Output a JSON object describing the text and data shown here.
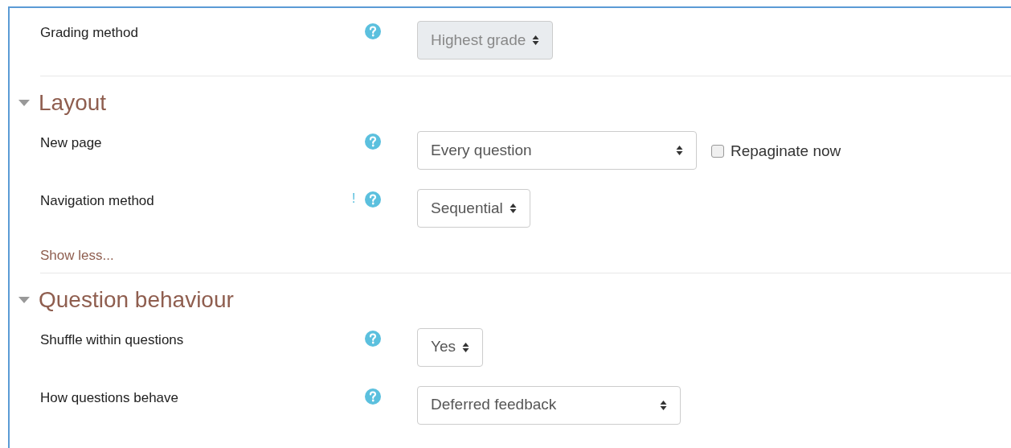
{
  "top_fields": [
    {
      "label": "Grading method",
      "help": true,
      "select": {
        "value": "Highest grade",
        "disabled": true,
        "kind": "auto"
      }
    }
  ],
  "sections": [
    {
      "title": "Layout",
      "expanded": true,
      "fields": [
        {
          "label": "New page",
          "help": true,
          "select": {
            "value": "Every question",
            "disabled": false,
            "kind": "wide"
          },
          "checkbox": {
            "label": "Repaginate now",
            "checked": false
          }
        },
        {
          "label": "Navigation method",
          "advanced_mark": "!",
          "help": true,
          "select": {
            "value": "Sequential",
            "disabled": false,
            "kind": "auto"
          }
        }
      ],
      "toggle_link": "Show less..."
    },
    {
      "title": "Question behaviour",
      "expanded": true,
      "fields": [
        {
          "label": "Shuffle within questions",
          "help": true,
          "select": {
            "value": "Yes",
            "disabled": false,
            "kind": "auto"
          }
        },
        {
          "label": "How questions behave",
          "help": true,
          "select": {
            "value": "Deferred feedback",
            "disabled": false,
            "kind": "wide2"
          }
        }
      ]
    }
  ]
}
